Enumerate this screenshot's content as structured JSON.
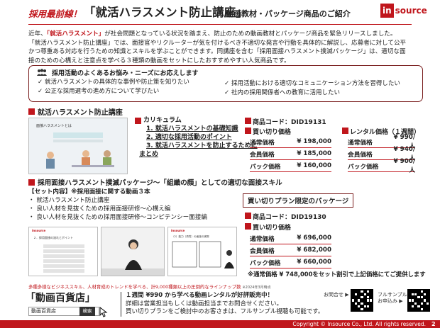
{
  "header": {
    "tag": "採用最前線！",
    "title": "「就活ハラスメント防止講座」",
    "subtitle": "動画教材・パッケージ商品のご紹介",
    "logo_part1": "in",
    "logo_part2": "source"
  },
  "intro": {
    "line1_prefix": "近年、",
    "line1_highlight": "「就活ハラスメント」",
    "line1_suffix": "が社会問題となっている状況を踏まえ、防止のための動画教材とパッケージ商品を緊急リリースしました。",
    "line2": "「就活ハラスメント防止講座」では、面接官やリクルーターが気を付けるべき不適切な発言や行動を具体的に解説し、応募者に対して公平",
    "line3": "かつ尊重ある対応を行うための知識とスキルを学ぶことができます。同講座を含む「採用面接ハラスメント撲滅パッケージ」は、適切な面",
    "line4": "接のための心構えと注意点を学べる３種類の動画をセットにしたおすすめやすい人気商品です。"
  },
  "concerns": {
    "title": "採用活動のよくあるお悩み・ニーズにお応えします",
    "items": [
      "就活ハラスメントの具体的な事例や防止策を知りたい",
      "公正な採用選考の進め方について学びたい",
      "採用活動における適切なコミュニケーション方法を習得したい",
      "社内の採用関係者への教育に活用したい"
    ]
  },
  "course": {
    "heading": "就活ハラスメント防止講座",
    "curriculum_title": "カリキュラム",
    "curriculum": [
      "1. 就活ハラスメントの基礎知識",
      "2. 適切な採用活動のポイント",
      "3. 就活ハラスメントを防止するために",
      "まとめ"
    ],
    "product_code": "商品コード：DID19131",
    "buy_title": "買い切り価格",
    "buy_prices": [
      {
        "label": "通常価格",
        "value": "¥ 198,000"
      },
      {
        "label": "会員価格",
        "value": "¥ 185,000"
      },
      {
        "label": "パック価格",
        "value": "¥ 160,000"
      }
    ],
    "rental_title": "レンタル価格（１週間）",
    "rental_prices": [
      {
        "label": "通常価格",
        "value": "¥ 990/人"
      },
      {
        "label": "会員価格",
        "value": "¥ 940/人"
      },
      {
        "label": "パック価格",
        "value": "¥ 900/人"
      }
    ]
  },
  "package": {
    "heading": "採用面接ハラスメント撲滅パッケージ～「組織の顔」としての適切な面接スキル",
    "set_title": "【セット内容】※採用面接に関する動画３本",
    "set_items": [
      "就活ハラスメント防止講座",
      "良い人材を見抜くための採用面接研修～心構え編",
      "良い人材を見抜くための採用面接研修～コンピテンシー面接編"
    ],
    "limited_label": "買い切りプラン限定のパッケージ",
    "product_code": "商品コード：DID19130",
    "buy_title": "買い切り価格",
    "buy_prices": [
      {
        "label": "通常価格",
        "value": "¥ 696,000"
      },
      {
        "label": "会員価格",
        "value": "¥ 682,000"
      },
      {
        "label": "パック価格",
        "value": "¥ 660,000"
      }
    ],
    "note": "※通常価格 ¥ 748,000をセット割引で上記価格にてご提供します"
  },
  "thumbs": {
    "slide1_title": "面接ハラスメントとは",
    "slide2_title": "２．採用面接の流れとポイント",
    "slide3_title": "（2）能力（資質）の面接の実際",
    "logo_small": "insource"
  },
  "promo": {
    "tagline": "多種多様なビジネススキル、人材育成のトレンドを学べる、計9,000種類以上の圧倒的なラインナップ数",
    "footnote": "※2024年3月時点",
    "store_name": "「動画百貨店」",
    "search_value": "動画百貨店",
    "search_button": "検索",
    "rental_line1": "１週間 ¥990 から学べる動画レンタルが好評販売中！",
    "rental_line2": "詳細は営業担当もしくは動画担当までお問合せください。",
    "rental_line3": "買い切りプランをご検討中のお客さまは、フルサンプル視聴も可能です。",
    "contact_label": "お問合せ",
    "sample_label": "フルサンプル",
    "sample_label2": "お申込み"
  },
  "footer": {
    "copyright": "Copyright © Insource Co., Ltd. All rights reserved.",
    "page": "2"
  },
  "colors": {
    "accent": "#c0161c",
    "dark_border": "#7a1e1e"
  }
}
